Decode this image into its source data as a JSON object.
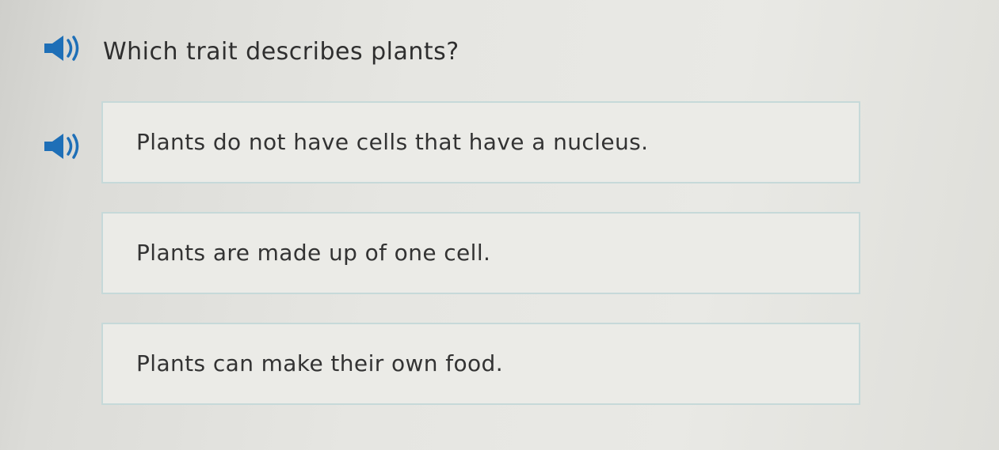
{
  "question": {
    "text": "Which trait describes plants?",
    "audio_icon": "speaker-icon"
  },
  "options": [
    {
      "label": "Plants do not have cells that have a nucleus.",
      "audio_icon": "speaker-icon"
    },
    {
      "label": "Plants are made up of one cell."
    },
    {
      "label": "Plants can make their own food."
    }
  ],
  "colors": {
    "text": "#333333",
    "option_border": "#c6d9d9",
    "option_bg": "#ebebe7",
    "speaker_blue": "#1e6fb7"
  }
}
